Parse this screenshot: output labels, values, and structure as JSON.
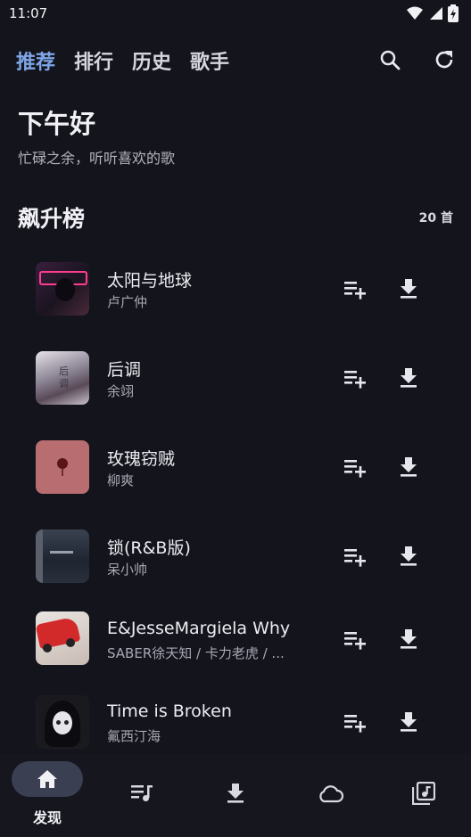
{
  "status": {
    "time": "11:07"
  },
  "tabs": [
    {
      "label": "推荐",
      "active": true
    },
    {
      "label": "排行"
    },
    {
      "label": "历史"
    },
    {
      "label": "歌手"
    }
  ],
  "greeting": {
    "title": "下午好",
    "subtitle": "忙碌之余，听听喜欢的歌"
  },
  "section": {
    "title": "飙升榜",
    "count": "20 首"
  },
  "songs": [
    {
      "title": "太阳与地球",
      "artist": "卢广仲"
    },
    {
      "title": "后调",
      "artist": "余翊"
    },
    {
      "title": "玫瑰窃贼",
      "artist": "柳爽"
    },
    {
      "title": "锁(R&B版)",
      "artist": "呆小帅"
    },
    {
      "title": "E&JesseMargiela    Why",
      "artist": "SABER徐天知 / 卡力老虎 / ..."
    },
    {
      "title": "Time is Broken",
      "artist": "氟西汀海"
    }
  ],
  "bottom_nav": [
    {
      "label": "发现",
      "icon": "home-icon",
      "active": true
    },
    {
      "icon": "playlist-icon"
    },
    {
      "icon": "download-icon"
    },
    {
      "icon": "cloud-icon"
    },
    {
      "icon": "music-library-icon"
    }
  ],
  "colors": {
    "background": "#14141c",
    "accent": "#7fa6e8",
    "active_pill": "#3a3f52"
  }
}
